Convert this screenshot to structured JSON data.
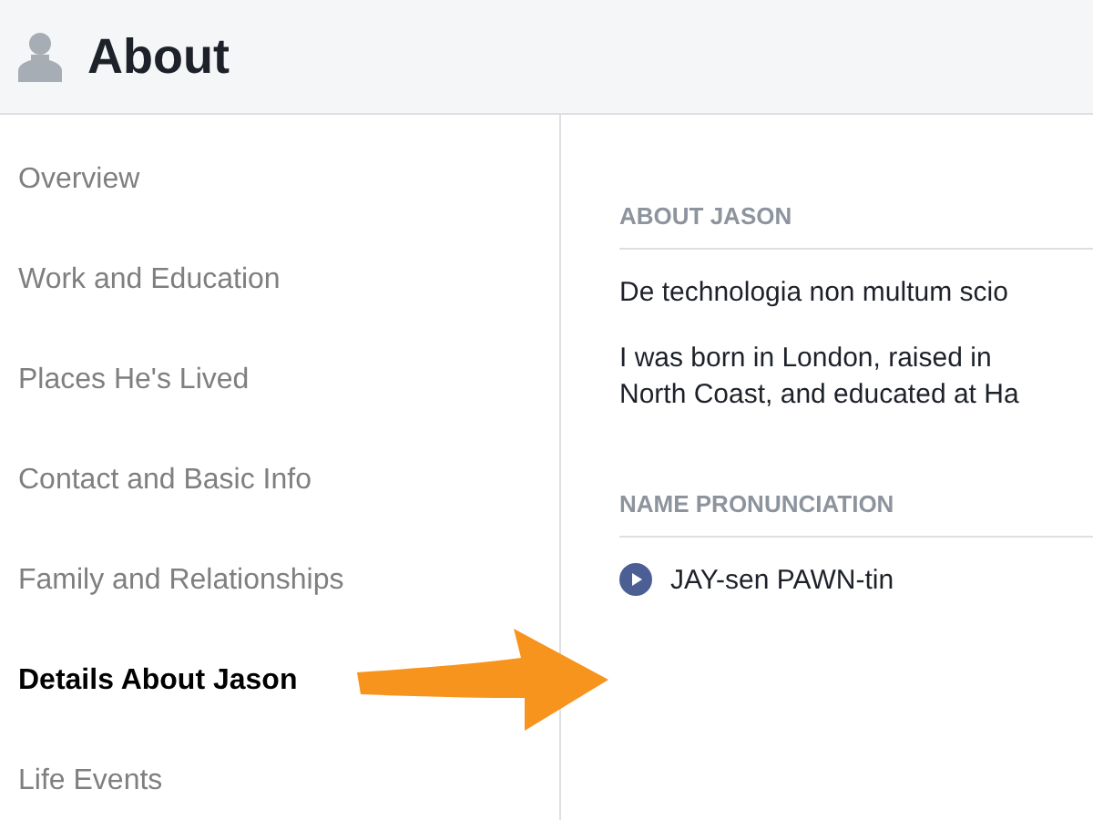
{
  "header": {
    "title": "About"
  },
  "sidebar": {
    "items": [
      {
        "label": "Overview",
        "selected": false
      },
      {
        "label": "Work and Education",
        "selected": false
      },
      {
        "label": "Places He's Lived",
        "selected": false
      },
      {
        "label": "Contact and Basic Info",
        "selected": false
      },
      {
        "label": "Family and Relationships",
        "selected": false
      },
      {
        "label": "Details About Jason",
        "selected": true
      },
      {
        "label": "Life Events",
        "selected": false
      }
    ]
  },
  "sections": [
    {
      "heading": "ABOUT JASON",
      "paragraphs": [
        "De technologia non multum scio",
        "I was born in London, raised in\nNorth Coast, and educated at Ha"
      ]
    },
    {
      "heading": "NAME PRONUNCIATION",
      "pronunciation": "JAY-sen PAWN-tin"
    }
  ]
}
